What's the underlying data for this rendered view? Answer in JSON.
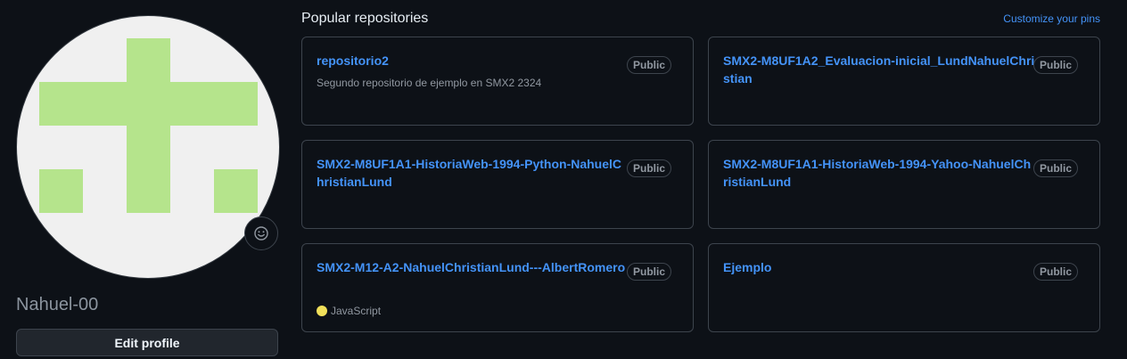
{
  "profile": {
    "username": "Nahuel-00",
    "edit_button_label": "Edit profile",
    "avatar_color": "#b5e48c",
    "status_icon": "smiley-icon"
  },
  "pinned": {
    "title": "Popular repositories",
    "customize_link": "Customize your pins",
    "repos": [
      {
        "name": "repositorio2",
        "visibility": "Public",
        "description": "Segundo repositorio de ejemplo en SMX2 2324",
        "language": "",
        "language_color": ""
      },
      {
        "name": "SMX2-M8UF1A2_Evaluacion-inicial_LundNahuelChristian",
        "visibility": "Public",
        "description": "",
        "language": "",
        "language_color": ""
      },
      {
        "name": "SMX2-M8UF1A1-HistoriaWeb-1994-Python-NahuelChristianLund",
        "visibility": "Public",
        "description": "",
        "language": "",
        "language_color": ""
      },
      {
        "name": "SMX2-M8UF1A1-HistoriaWeb-1994-Yahoo-NahuelChristianLund",
        "visibility": "Public",
        "description": "",
        "language": "",
        "language_color": ""
      },
      {
        "name": "SMX2-M12-A2-NahuelChristianLund---AlbertRomero",
        "visibility": "Public",
        "description": "",
        "language": "JavaScript",
        "language_color": "#f1e05a"
      },
      {
        "name": "Ejemplo",
        "visibility": "Public",
        "description": "",
        "language": "",
        "language_color": ""
      }
    ]
  }
}
